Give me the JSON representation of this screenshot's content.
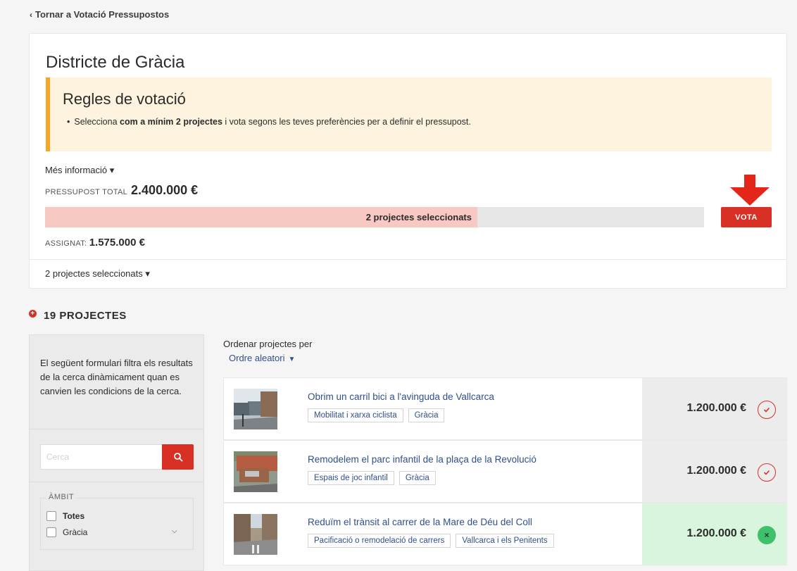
{
  "nav": {
    "back_chevron": "‹",
    "back_label": "Tornar a Votació Pressupostos"
  },
  "district": {
    "title": "Districte de Gràcia"
  },
  "rules": {
    "title": "Regles de votació",
    "item_prefix": "Selecciona ",
    "item_bold": "com a mínim 2 projectes",
    "item_suffix": " i vota segons les teves preferències per a definir el pressupost."
  },
  "more_info": {
    "label": "Més informació ▾"
  },
  "budget": {
    "total_label": "PRESSUPOST TOTAL",
    "total_amount": "2.400.000 €",
    "assigned_label": "ASSIGNAT:",
    "assigned_amount": "1.575.000 €",
    "progress_fraction": 0.6562,
    "progress_label": "2 projectes seleccionats"
  },
  "vote_button": {
    "label": "VOTA"
  },
  "selected_toggle": {
    "label": "2 projectes seleccionats ▾"
  },
  "projects_heading": {
    "label": "19 PROJECTES"
  },
  "filters": {
    "description": "El següent formulari filtra els resultats de la cerca dinàmicament quan es canvien les condicions de la cerca.",
    "search_placeholder": "Cerca",
    "scope_legend": "ÀMBIT",
    "options": [
      {
        "label": "Totes"
      },
      {
        "label": "Gràcia"
      }
    ]
  },
  "sort": {
    "label": "Ordenar projectes per",
    "value": "Ordre aleatori"
  },
  "projects": [
    {
      "title": "Obrim un carril bici a l'avinguda de Vallcarca",
      "tags": [
        "Mobilitat i xarxa ciclista",
        "Gràcia"
      ],
      "price": "1.200.000 €",
      "selected": false
    },
    {
      "title": "Remodelem el parc infantil de la plaça de la Revolució",
      "tags": [
        "Espais de joc infantil",
        "Gràcia"
      ],
      "price": "1.200.000 €",
      "selected": false
    },
    {
      "title": "Reduïm el trànsit al carrer de la Mare de Déu del Coll",
      "tags": [
        "Pacificació o remodelació de carrers",
        "Vallcarca i els Penitents"
      ],
      "price": "1.200.000 €",
      "selected": true
    }
  ],
  "colors": {
    "accent_red": "#d93025",
    "progress_fill": "#f8c9c3",
    "selected_green": "#3ec16a",
    "link_blue": "#2f4f8c",
    "rules_border": "#f5a623"
  }
}
